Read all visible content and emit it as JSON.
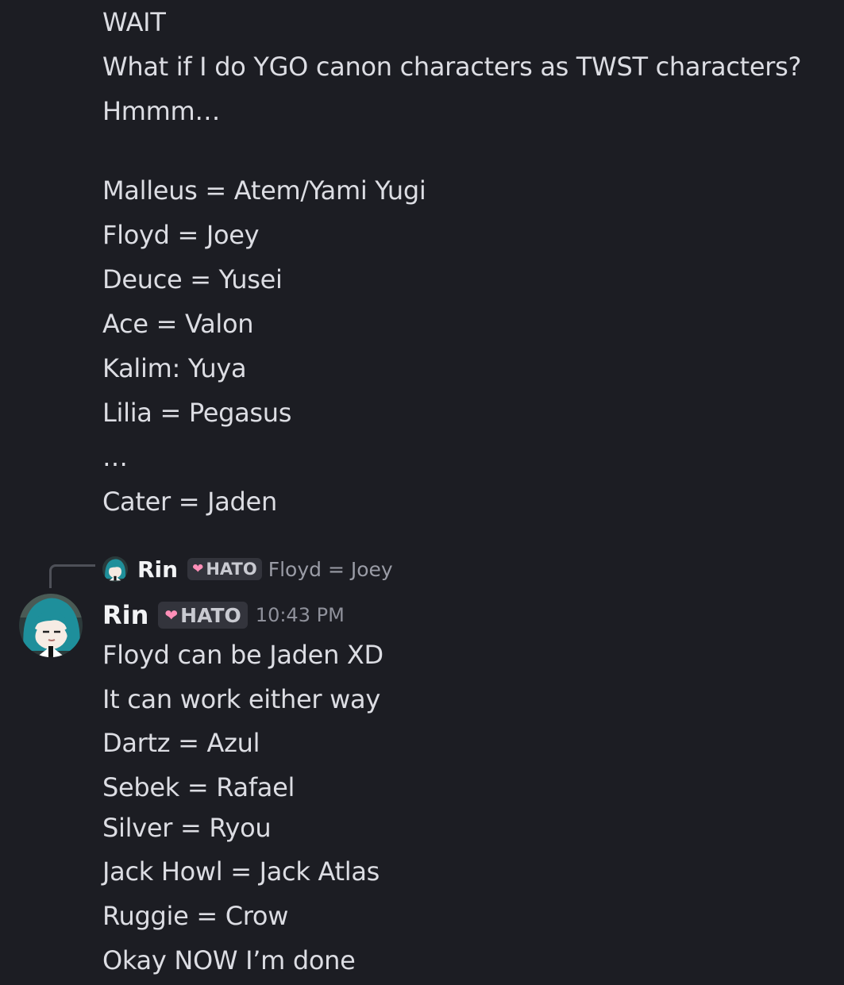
{
  "previous_message": {
    "lines": [
      "WAIT",
      "What if I do YGO canon characters as TWST characters?",
      "Hmmm…",
      "Malleus = Atem/Yami Yugi",
      "Floyd = Joey",
      "Deuce = Yusei",
      "Ace = Valon",
      "Kalim: Yuya",
      "Lilia = Pegasus",
      "…",
      "Cater = Jaden"
    ]
  },
  "reply": {
    "author": "Rin",
    "tag_icon": "heart-icon",
    "tag": "HATO",
    "snippet": "Floyd = Joey"
  },
  "message": {
    "author": "Rin",
    "tag_icon": "heart-icon",
    "tag": "HATO",
    "timestamp": "10:43 PM",
    "lines": [
      "Floyd can be Jaden XD",
      "It can work either way",
      "Dartz = Azul",
      "Sebek = Rafael",
      "Silver = Ryou",
      "Jack Howl = Jack Atlas",
      "Ruggie = Crow",
      "Okay NOW I’m done"
    ]
  },
  "colors": {
    "background": "#1c1d23",
    "text": "#dcdde3",
    "username": "#f2f3f5",
    "tag_heart": "#ff8fb8",
    "timestamp": "#8f919b"
  }
}
